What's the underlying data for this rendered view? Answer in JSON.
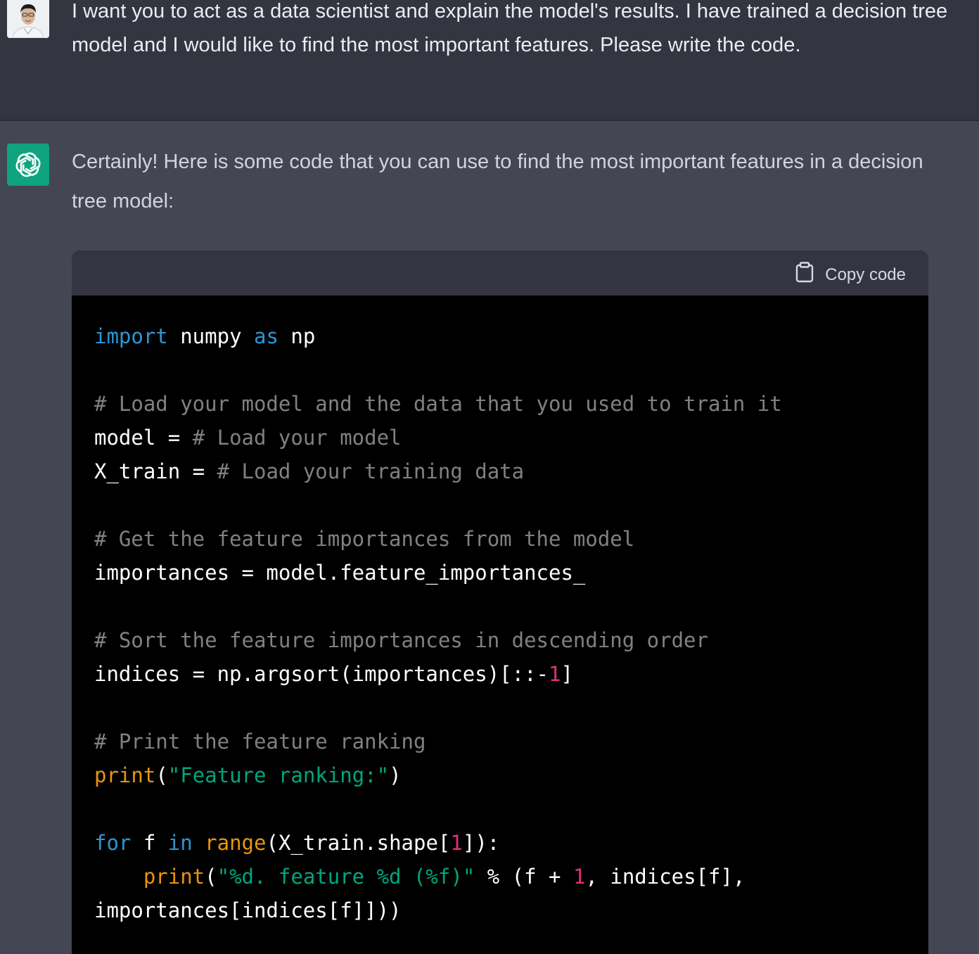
{
  "user_message": {
    "text": "I want you to act as a data scientist and explain the model's results. I have trained a decision tree model and I would like to find the most important features. Please write the code."
  },
  "assistant_message": {
    "intro": "Certainly! Here is some code that you can use to find the most important features in a decision tree model:",
    "code_block": {
      "copy_label": "Copy code",
      "lines": [
        [
          {
            "t": "import",
            "c": "kw"
          },
          {
            "t": " numpy "
          },
          {
            "t": "as",
            "c": "kw"
          },
          {
            "t": " np"
          }
        ],
        [],
        [
          {
            "t": "# Load your model and the data that you used to train it",
            "c": "cm"
          }
        ],
        [
          {
            "t": "model = "
          },
          {
            "t": "# Load your model",
            "c": "cm"
          }
        ],
        [
          {
            "t": "X_train = "
          },
          {
            "t": "# Load your training data",
            "c": "cm"
          }
        ],
        [],
        [
          {
            "t": "# Get the feature importances from the model",
            "c": "cm"
          }
        ],
        [
          {
            "t": "importances = model.feature_importances_"
          }
        ],
        [],
        [
          {
            "t": "# Sort the feature importances in descending order",
            "c": "cm"
          }
        ],
        [
          {
            "t": "indices = np.argsort(importances)[::-"
          },
          {
            "t": "1",
            "c": "nm"
          },
          {
            "t": "]"
          }
        ],
        [],
        [
          {
            "t": "# Print the feature ranking",
            "c": "cm"
          }
        ],
        [
          {
            "t": "print",
            "c": "fn"
          },
          {
            "t": "("
          },
          {
            "t": "\"Feature ranking:\"",
            "c": "st"
          },
          {
            "t": ")"
          }
        ],
        [],
        [
          {
            "t": "for",
            "c": "kw"
          },
          {
            "t": " f "
          },
          {
            "t": "in",
            "c": "kw"
          },
          {
            "t": " "
          },
          {
            "t": "range",
            "c": "fn"
          },
          {
            "t": "(X_train.shape["
          },
          {
            "t": "1",
            "c": "nm"
          },
          {
            "t": "]):"
          }
        ],
        [
          {
            "t": "    "
          },
          {
            "t": "print",
            "c": "fn"
          },
          {
            "t": "("
          },
          {
            "t": "\"%d. feature %d (%f)\"",
            "c": "st"
          },
          {
            "t": " % (f + "
          },
          {
            "t": "1",
            "c": "nm"
          },
          {
            "t": ", indices[f],"
          }
        ],
        [
          {
            "t": "importances[indices[f]]))"
          }
        ]
      ]
    }
  },
  "colors": {
    "user_bg": "#343541",
    "assistant_bg": "#444654",
    "brand_green": "#10a37f",
    "code_bg": "#000000"
  },
  "icons": {
    "assistant_avatar": "openai-logo-icon",
    "copy": "clipboard-icon"
  }
}
